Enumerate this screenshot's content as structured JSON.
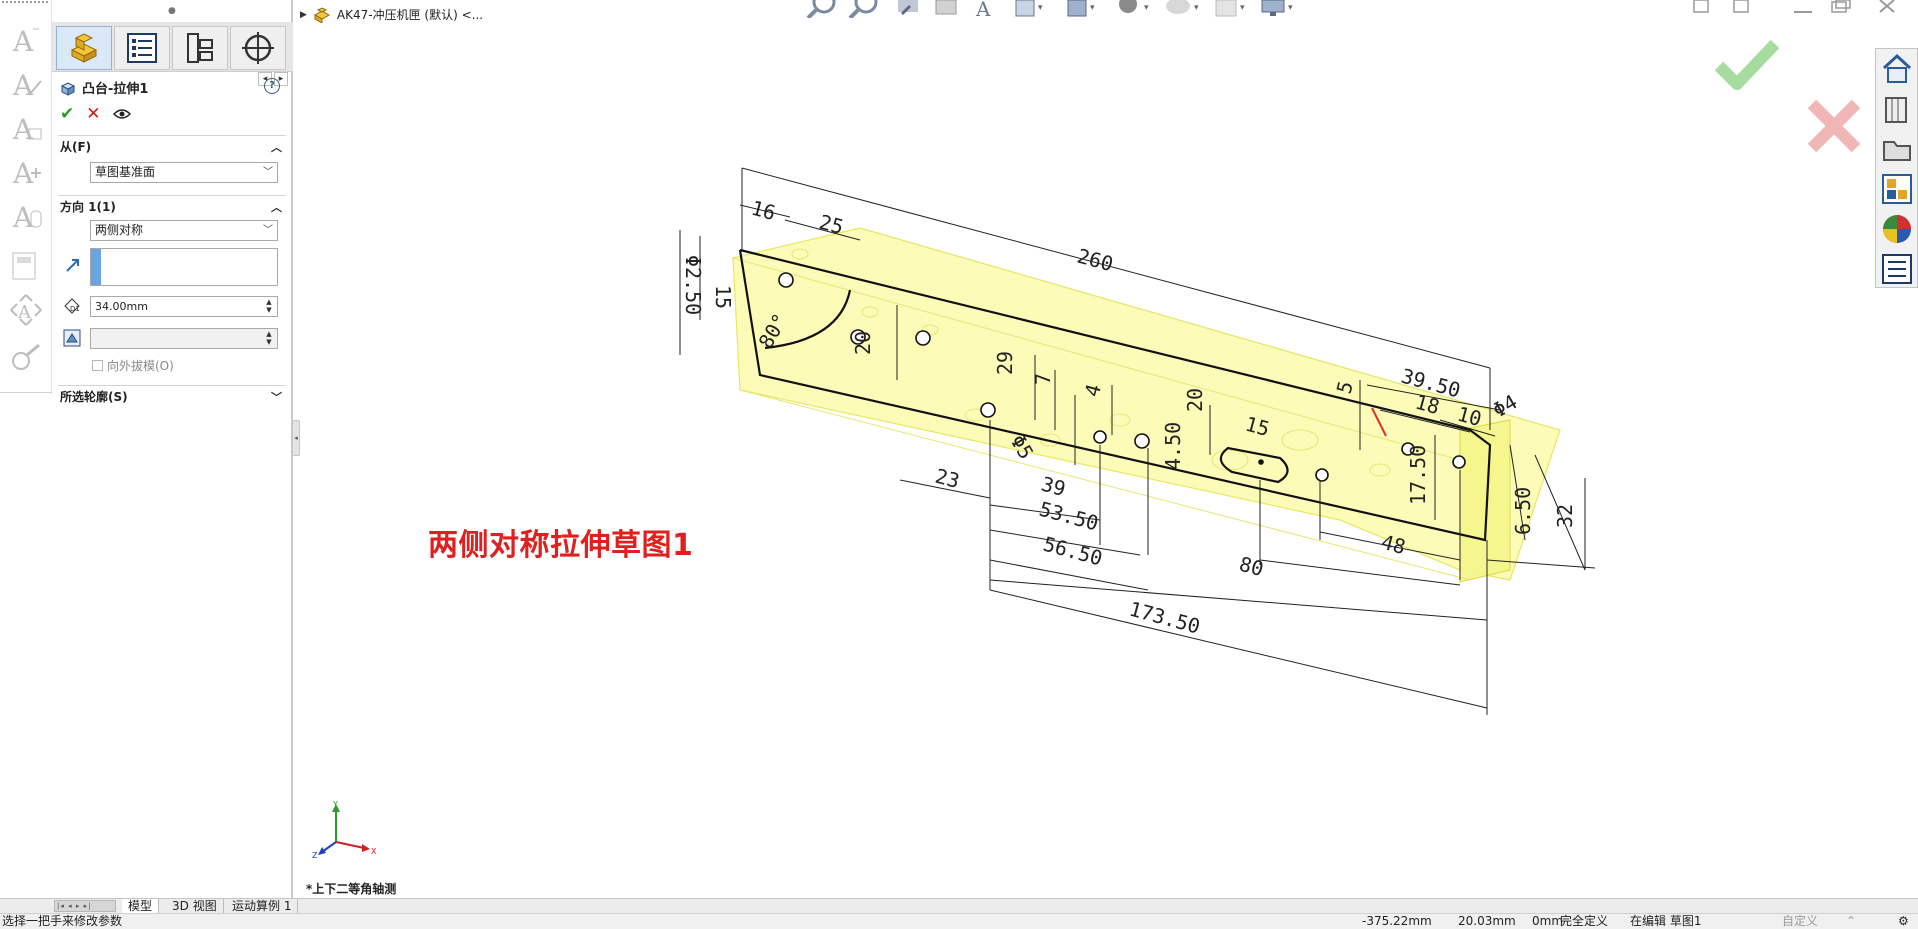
{
  "document": {
    "title": "AK47-冲压机匣 (默认) <..."
  },
  "feature": {
    "title": "凸台-拉伸1",
    "help": "?"
  },
  "from": {
    "header": "从(F)",
    "value": "草图基准面"
  },
  "direction1": {
    "header": "方向 1(1)",
    "end_condition": "两侧对称",
    "depth": "34.00mm",
    "draft_value": "",
    "draft_outward_label": "向外拔模(O)"
  },
  "selected_contours": {
    "header": "所选轮廓(S)"
  },
  "annotation": {
    "label": "两侧对称拉伸草图1"
  },
  "sketch_dims": {
    "d260": "260",
    "d16": "16",
    "d25": "25",
    "d15": "15",
    "d80deg": "80°",
    "d20a": "20",
    "dphi2": "Φ2.50",
    "d29": "29",
    "d7": "7",
    "d4": "4",
    "d20b": "20",
    "d4_50": "4.50",
    "d15b": "15",
    "d5_5": "Φ5",
    "d23": "23",
    "d39": "39",
    "d53_50": "53.50",
    "d56_50": "56.50",
    "d173_50": "173.50",
    "d39_50": "39.50",
    "d18": "18",
    "d10": "10",
    "d5": "5",
    "dphi4": "Φ4",
    "d17_50": "17.50",
    "d6_50": "6.50",
    "d32": "32",
    "d48": "48",
    "d80": "80"
  },
  "triad": {
    "x": "X",
    "y": "Y",
    "z": "Z"
  },
  "view": {
    "name": "*上下二等角轴测"
  },
  "bottom_tabs": [
    "模型",
    "3D 视图",
    "运动算例 1"
  ],
  "status": {
    "hint": "选择一把手来修改参数",
    "x": "-375.22mm",
    "y": "20.03mm",
    "z": "0mm",
    "state": "完全定义",
    "editing": "在编辑 草图1",
    "custom": "自定义"
  },
  "icons": {
    "cmd_strip": [
      "text-annotation-icon",
      "spell-annotation-icon",
      "leader-note-icon",
      "balloon-icon",
      "stack-icon",
      "surface-finish-icon",
      "datum-icon",
      "weld-icon"
    ],
    "pm_tabs": [
      "feature-manager-icon",
      "property-manager-icon",
      "configuration-manager-icon",
      "dimxpert-icon"
    ],
    "task_pane": [
      "home-icon",
      "design-library-icon",
      "file-explorer-icon",
      "view-palette-icon",
      "appearances-icon",
      "custom-properties-icon"
    ]
  },
  "colors": {
    "accent_blue": "#6aa4e2",
    "ok_green": "#2e9a2e",
    "cancel_red": "#d01818",
    "annotation_red": "#e0201e",
    "part_yellow": "#fbfba0"
  }
}
